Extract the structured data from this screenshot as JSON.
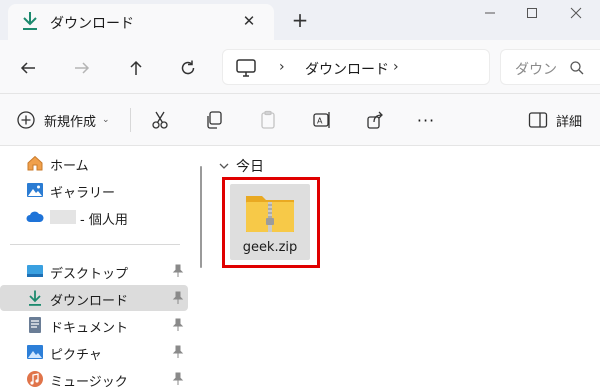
{
  "tab": {
    "title": "ダウンロード",
    "close": "✕"
  },
  "new_tab": "+",
  "address": {
    "crumb": "ダウンロード",
    "sep1": "›",
    "sep2": "›"
  },
  "search": {
    "placeholder": "ダウン"
  },
  "toolbar": {
    "new_label": "新規作成",
    "new_dropdown": "⌄",
    "detail_label": "詳細",
    "more": "···"
  },
  "sidebar": {
    "home": "ホーム",
    "gallery": "ギャラリー",
    "onedrive_suffix": "- 個人用",
    "desktop": "デスクトップ",
    "downloads": "ダウンロード",
    "documents": "ドキュメント",
    "pictures": "ピクチャ",
    "music": "ミュージック"
  },
  "main": {
    "group_label": "今日",
    "files": [
      {
        "name": "geek.zip"
      }
    ]
  },
  "colors": {
    "accent": "#0f7b6c",
    "highlight": "#e00000",
    "folder": "#f7c948"
  }
}
